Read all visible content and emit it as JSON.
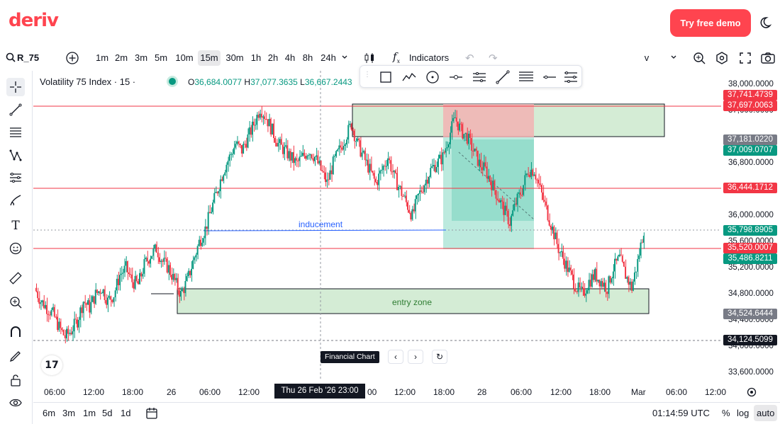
{
  "header": {
    "logo": "deriv",
    "demo_button": "Try free demo",
    "theme_icon": "moon-icon"
  },
  "toolbar": {
    "symbol": "R_75",
    "intervals": [
      "1m",
      "2m",
      "3m",
      "5m",
      "10m",
      "15m",
      "30m",
      "1h",
      "2h",
      "4h",
      "8h",
      "24h"
    ],
    "active_interval": "15m",
    "indicators_label": "Indicators",
    "chart_type_label": "v"
  },
  "legend": {
    "title": "Volatility 75 Index · 15 ·",
    "open_label": "O",
    "open": "36,684.0077",
    "high_label": "H",
    "high": "37,077.3635",
    "low_label": "L",
    "low": "36,667.2443"
  },
  "price_scale": [
    "38,000.0000",
    "37,600.0000",
    "36,800.0000",
    "36,400.0000",
    "36,000.0000",
    "35,600.0000",
    "35,200.0000",
    "34,800.0000",
    "34,400.0000",
    "34,000.0000",
    "33,600.0000"
  ],
  "price_labels": [
    {
      "value": "37,741.4739",
      "color": "#f23645"
    },
    {
      "value": "37,697.0063",
      "color": "#f23645"
    },
    {
      "value": "37,181.0220",
      "color": "#787b86"
    },
    {
      "value": "37,009.0707",
      "color": "#089981"
    },
    {
      "value": "36,444.1712",
      "color": "#f23645"
    },
    {
      "value": "35,798.8905",
      "color": "#089981"
    },
    {
      "value": "35,520.0007",
      "color": "#f23645"
    },
    {
      "value": "35,486.8211",
      "color": "#089981"
    },
    {
      "value": "34,524.6444",
      "color": "#787b86"
    },
    {
      "value": "34,124.5099",
      "color": "#131722"
    }
  ],
  "annotations": {
    "inducement": "inducement",
    "entry_zone": "entry zone"
  },
  "time_axis": [
    "06:00",
    "12:00",
    "18:00",
    "26",
    "06:00",
    "12:00",
    "00",
    "12:00",
    "18:00",
    "28",
    "06:00",
    "12:00",
    "18:00",
    "Mar",
    "06:00",
    "12:00"
  ],
  "crosshair_time": "Thu 26 Feb '26   23:00",
  "nav": {
    "tooltip": "Financial Chart"
  },
  "bottom_bar": {
    "ranges": [
      "6m",
      "3m",
      "1m",
      "5d",
      "1d"
    ],
    "clock": "01:14:59 UTC",
    "percent": "%",
    "log": "log",
    "auto": "auto"
  },
  "colors": {
    "up": "#089981",
    "down": "#f23645",
    "brand": "#ff444f",
    "zone": "#c8e6c9",
    "short_red": "#f4a9ad",
    "short_green": "#7dd3bf"
  },
  "chart_data": {
    "type": "candlestick",
    "symbol": "R_75",
    "interval": "15m",
    "close_path": [
      34900,
      34700,
      34600,
      34500,
      34300,
      34150,
      34250,
      34400,
      34700,
      34600,
      34800,
      34900,
      34700,
      34800,
      35100,
      35200,
      35000,
      34950,
      35250,
      35400,
      35500,
      35300,
      35200,
      35000,
      34800,
      35000,
      35300,
      35600,
      35800,
      36100,
      36400,
      36700,
      36900,
      37100,
      37000,
      37200,
      37400,
      37650,
      37500,
      37300,
      37100,
      37000,
      36900,
      36800,
      36900,
      37000,
      36900,
      36700,
      36500,
      36800,
      37000,
      37200,
      37400,
      37100,
      36900,
      36700,
      36500,
      36700,
      36900,
      36600,
      36400,
      36200,
      36000,
      36300,
      36500,
      36700,
      36800,
      36900,
      37200,
      37500,
      37300,
      37200,
      37000,
      36800,
      36700,
      36500,
      36300,
      36100,
      35900,
      36200,
      36400,
      36700,
      36700,
      36400,
      36100,
      35800,
      35500,
      35300,
      35100,
      34900,
      34800,
      35000,
      35100,
      35000,
      34900,
      35200,
      35350,
      35100,
      34900,
      35300,
      35800
    ]
  }
}
